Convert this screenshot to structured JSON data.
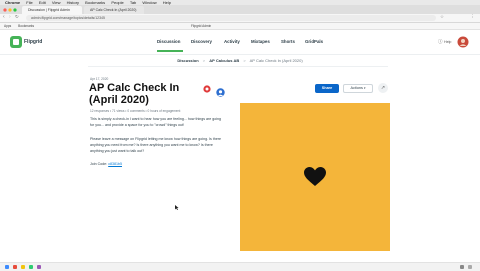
{
  "os_menubar": {
    "items": [
      "",
      "Chrome",
      "File",
      "Edit",
      "View",
      "History",
      "Bookmarks",
      "People",
      "Tab",
      "Window",
      "Help"
    ]
  },
  "browser": {
    "tabs": [
      {
        "label": "Discussion | Flipgrid Admin"
      },
      {
        "label": "AP Calc Check In (April 2020)"
      }
    ],
    "url": "admin.flipgrid.com/manage/topics/details/12345",
    "bookmarks": [
      "Apps",
      "Bookmarks",
      "Flipgrid Admin"
    ]
  },
  "header": {
    "logo_text": "Flipgrid",
    "nav": [
      "Discussion",
      "Discovery",
      "Activity",
      "Mixtapes",
      "Shorts",
      "GridPals"
    ],
    "active_nav": "Discussion",
    "help_label": "Help"
  },
  "breadcrumb": {
    "items": [
      "Discussion",
      "AP Calculus AB",
      "AP Calc Check In (April 2020)"
    ],
    "separator": ">"
  },
  "topic": {
    "date": "Apr 17, 2020",
    "title": "AP Calc Check In (April 2020)",
    "meta": "12 responses  •  71 views  •  0 comments  •  0 hours of engagement",
    "paragraph1": "This is simply a check-in I want to hear how you are feeling... how things are going for you... and provide a space for you to \"crowd\" things out!",
    "paragraph2": "Please leave a message on Flipgrid letting me know how things are going. Is there anything you need from me? Is there anything you want me to know? Is there anything you just want to talk out?",
    "join_label": "Join Code:",
    "join_code": "c8381b5"
  },
  "actions": {
    "share_label": "Share",
    "actions_label": "Actions",
    "more_icon": "ellipsis-icon"
  },
  "colors": {
    "accent": "#0a66c9",
    "topic_image_bg": "#f4b53a",
    "heart": "#111111",
    "active_nav": "#46b358"
  }
}
